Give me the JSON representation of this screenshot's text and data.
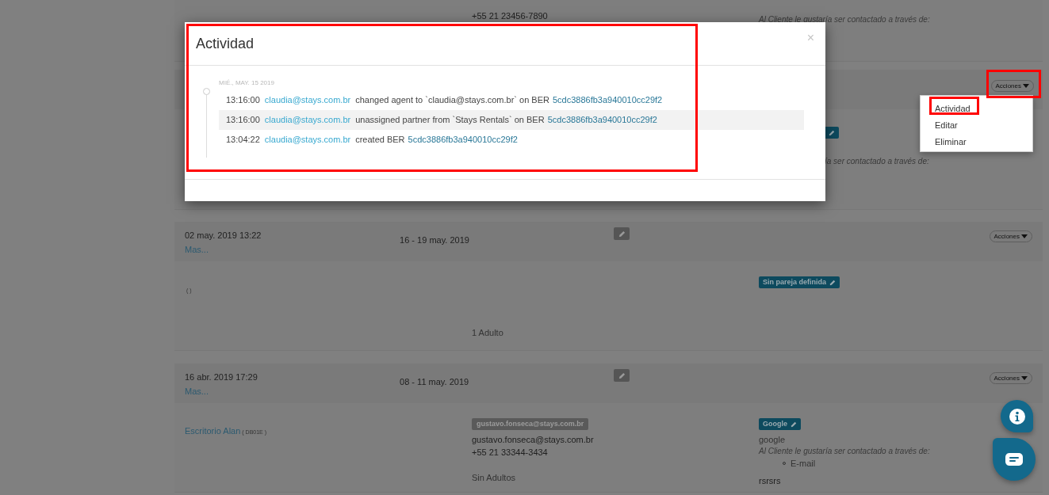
{
  "top_record": {
    "phone": "+55 21 23456-7890",
    "contact_note": "Al Cliente le gustaría ser contactado a través de:"
  },
  "partial_record": {
    "actions_button": "Acciones",
    "contact_note": "ía ser contactado a través de:"
  },
  "records": [
    {
      "created": "02 may. 2019 13:22",
      "more_link": "Mas...",
      "dates": "16 - 19 may. 2019",
      "actions_button": "Acciones",
      "property_code": "( )",
      "guests": "1 Adulto",
      "partner_badge": "Sin pareja definida"
    },
    {
      "created": "16 abr. 2019 17:29",
      "more_link": "Mas...",
      "dates": "08 - 11 may. 2019",
      "actions_button": "Acciones",
      "property_name": "Escritorio Alan",
      "property_code": "( DB01E )",
      "agent_badge": "gustavo.fonseca@stays.com.br",
      "email": "gustavo.fonseca@stays.com.br",
      "phone": "+55 21 33344-3434",
      "guests": "Sin Adultos",
      "partner_badge": "Google",
      "source": "google",
      "contact_note": "Al Cliente le gustaría ser contactado a través de:",
      "contact_methods": [
        "E-mail"
      ],
      "notes": "rsrsrs"
    }
  ],
  "modal": {
    "title": "Actividad",
    "close": "×",
    "day": "MIÉ., MAY. 15 2019",
    "entries": [
      {
        "time": "13:16:00",
        "user": "claudia@stays.com.br",
        "action": "changed agent to `claudia@stays.com.br` on BER",
        "ber": "5cdc3886fb3a940010cc29f2",
        "selected": false
      },
      {
        "time": "13:16:00",
        "user": "claudia@stays.com.br",
        "action": "unassigned partner from `Stays Rentals` on BER",
        "ber": "5cdc3886fb3a940010cc29f2",
        "selected": true
      },
      {
        "time": "13:04:22",
        "user": "claudia@stays.com.br",
        "action": "created BER",
        "ber": "5cdc3886fb3a940010cc29f2",
        "selected": false
      }
    ]
  },
  "dropdown": {
    "items": [
      "Actividad",
      "Editar",
      "Eliminar"
    ]
  }
}
